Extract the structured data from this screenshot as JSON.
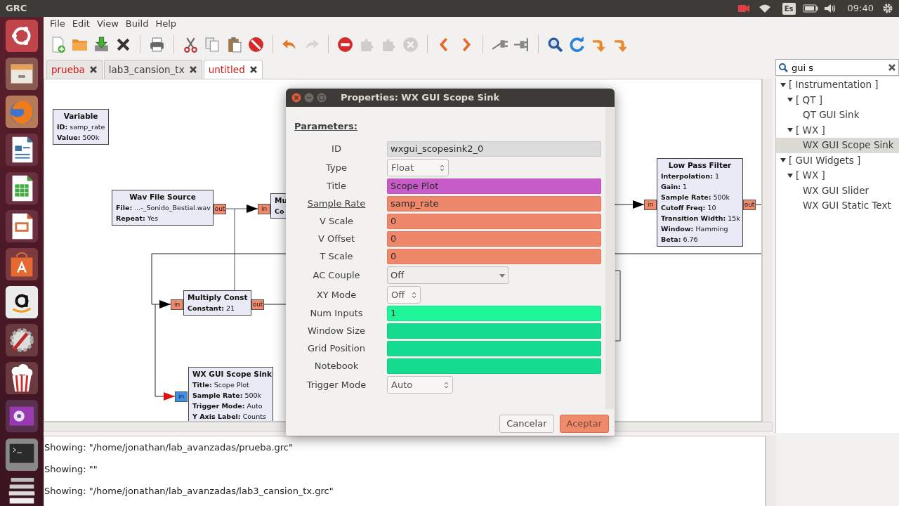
{
  "top_panel": {
    "title": "GRC",
    "keyboard": "Es",
    "time": "09:40"
  },
  "menu": [
    "File",
    "Edit",
    "View",
    "Build",
    "Help"
  ],
  "toolbar": [
    {
      "kind": "new",
      "disabled": false
    },
    {
      "kind": "open",
      "disabled": false
    },
    {
      "kind": "save",
      "disabled": false
    },
    {
      "kind": "close",
      "disabled": false
    },
    {
      "kind": "print",
      "disabled": false
    },
    {
      "kind": "cut",
      "disabled": false
    },
    {
      "kind": "copy",
      "disabled": false
    },
    {
      "kind": "paste",
      "disabled": false
    },
    {
      "kind": "stop",
      "disabled": false
    },
    {
      "kind": "undo",
      "disabled": false
    },
    {
      "kind": "redo",
      "disabled": true
    },
    {
      "kind": "error",
      "disabled": false
    },
    {
      "kind": "enable",
      "disabled": true
    },
    {
      "kind": "bypass",
      "disabled": true
    },
    {
      "kind": "delete",
      "disabled": true
    },
    {
      "kind": "prev",
      "disabled": false
    },
    {
      "kind": "next",
      "disabled": false
    },
    {
      "kind": "port_remove",
      "disabled": false
    },
    {
      "kind": "port_add",
      "disabled": false
    },
    {
      "kind": "find",
      "disabled": false
    },
    {
      "kind": "refresh",
      "disabled": false
    },
    {
      "kind": "rotate_ccw",
      "disabled": false
    },
    {
      "kind": "rotate_cw",
      "disabled": false
    }
  ],
  "tabs": [
    {
      "label": "prueba",
      "selected": false,
      "modified": true
    },
    {
      "label": "lab3_cansion_tx",
      "selected": false,
      "modified": false
    },
    {
      "label": "untitled",
      "selected": true,
      "modified": true
    }
  ],
  "search": {
    "value": "gui s"
  },
  "tree": [
    {
      "label": "[ Instrumentation ]",
      "expanded": true,
      "selected": false,
      "children": [
        {
          "label": "[ QT ]",
          "expanded": true,
          "selected": false,
          "children": [
            {
              "label": "QT GUI Sink",
              "selected": false
            }
          ]
        },
        {
          "label": "[ WX ]",
          "expanded": true,
          "selected": false,
          "children": [
            {
              "label": "WX GUI Scope Sink",
              "selected": true
            }
          ]
        }
      ]
    },
    {
      "label": "[ GUI Widgets ]",
      "expanded": true,
      "selected": false,
      "children": [
        {
          "label": "[ WX ]",
          "expanded": true,
          "selected": false,
          "children": [
            {
              "label": "WX GUI Slider",
              "selected": false
            },
            {
              "label": "WX GUI Static Text",
              "selected": false
            }
          ]
        }
      ]
    }
  ],
  "blocks": [
    {
      "title": "Variable",
      "params": [
        {
          "name": "ID:",
          "value": "samp_rate"
        },
        {
          "name": "Value:",
          "value": "500k"
        }
      ]
    },
    {
      "title": "Wav File Source",
      "params": [
        {
          "name": "File:",
          "value": "...-_Sonido_Bestial.wav"
        },
        {
          "name": "Repeat:",
          "value": "Yes"
        }
      ],
      "ports": [
        {
          "label": "out",
          "color": "#f08a6a"
        }
      ]
    },
    {
      "title": "Mu",
      "params": [
        {
          "name": "Co"
        }
      ],
      "ports": [
        {
          "label": "in",
          "color": "#f08a6a"
        }
      ]
    },
    {
      "title": "Multiply Const",
      "params": [
        {
          "name": "Constant:",
          "value": "21"
        }
      ],
      "ports": [
        {
          "label": "in",
          "color": "#f08a6a"
        },
        {
          "label": "out",
          "color": "#f08a6a"
        }
      ]
    },
    {
      "title": "WX GUI Scope Sink",
      "params": [
        {
          "name": "Title:",
          "value": "Scope Plot"
        },
        {
          "name": "Sample Rate:",
          "value": "500k"
        },
        {
          "name": "Trigger Mode:",
          "value": "Auto"
        },
        {
          "name": "Y Axis Label:",
          "value": "Counts"
        }
      ],
      "ports": [
        {
          "label": "in",
          "color": "#3d8fe8"
        }
      ]
    },
    {
      "title": "Low Pass Filter",
      "params": [
        {
          "name": "Interpolation:",
          "value": "1"
        },
        {
          "name": "Gain:",
          "value": "1"
        },
        {
          "name": "Sample Rate:",
          "value": "500k"
        },
        {
          "name": "Cutoff Freq:",
          "value": "10"
        },
        {
          "name": "Transition Width:",
          "value": "15k"
        },
        {
          "name": "Window:",
          "value": "Hamming"
        },
        {
          "name": "Beta:",
          "value": "6.76"
        }
      ],
      "ports": [
        {
          "label": "in",
          "color": "#f08a6a"
        },
        {
          "label": "out",
          "color": "#f08a6a"
        }
      ]
    }
  ],
  "log": [
    "Showing: \"/home/jonathan/lab_avanzadas/prueba.grc\"",
    "Showing: \"\"",
    "Showing: \"/home/jonathan/lab_avanzadas/lab3_cansion_tx.grc\""
  ],
  "dialog": {
    "title": "Properties: WX GUI Scope Sink",
    "section": "Parameters:",
    "params": [
      {
        "label": "ID",
        "kind": "entry",
        "value": "wxgui_scopesink2_0",
        "color": "#dcdcdc",
        "underlined": false
      },
      {
        "label": "Type",
        "kind": "spin",
        "value": "Float",
        "underlined": false
      },
      {
        "label": "Title",
        "kind": "entry",
        "value": "Scope Plot",
        "color": "#c75bc7",
        "underlined": false
      },
      {
        "label": "Sample Rate",
        "kind": "entry",
        "value": "samp_rate",
        "color": "#ef876a",
        "underlined": true
      },
      {
        "label": "V Scale",
        "kind": "entry",
        "value": "0",
        "color": "#ef876a",
        "underlined": false
      },
      {
        "label": "V Offset",
        "kind": "entry",
        "value": "0",
        "color": "#ef876a",
        "underlined": false
      },
      {
        "label": "T Scale",
        "kind": "entry",
        "value": "0",
        "color": "#ef876a",
        "underlined": false
      },
      {
        "label": "AC Couple",
        "kind": "combo",
        "value": "Off",
        "underlined": false
      },
      {
        "label": "XY Mode",
        "kind": "spin",
        "value": "Off",
        "underlined": false
      },
      {
        "label": "Num Inputs",
        "kind": "entry",
        "value": "1",
        "color": "#1ef598",
        "underlined": false
      },
      {
        "label": "Window Size",
        "kind": "entry",
        "color": "#16dc92",
        "underlined": false
      },
      {
        "label": "Grid Position",
        "kind": "entry",
        "color": "#16dc92",
        "underlined": false
      },
      {
        "label": "Notebook",
        "kind": "entry",
        "color": "#16dc92",
        "underlined": false
      },
      {
        "label": "Trigger Mode",
        "kind": "spin",
        "value": "Auto",
        "underlined": false
      }
    ],
    "buttons": [
      {
        "label": "Cancelar",
        "kind": "normal"
      },
      {
        "label": "Aceptar",
        "kind": "default"
      }
    ]
  }
}
